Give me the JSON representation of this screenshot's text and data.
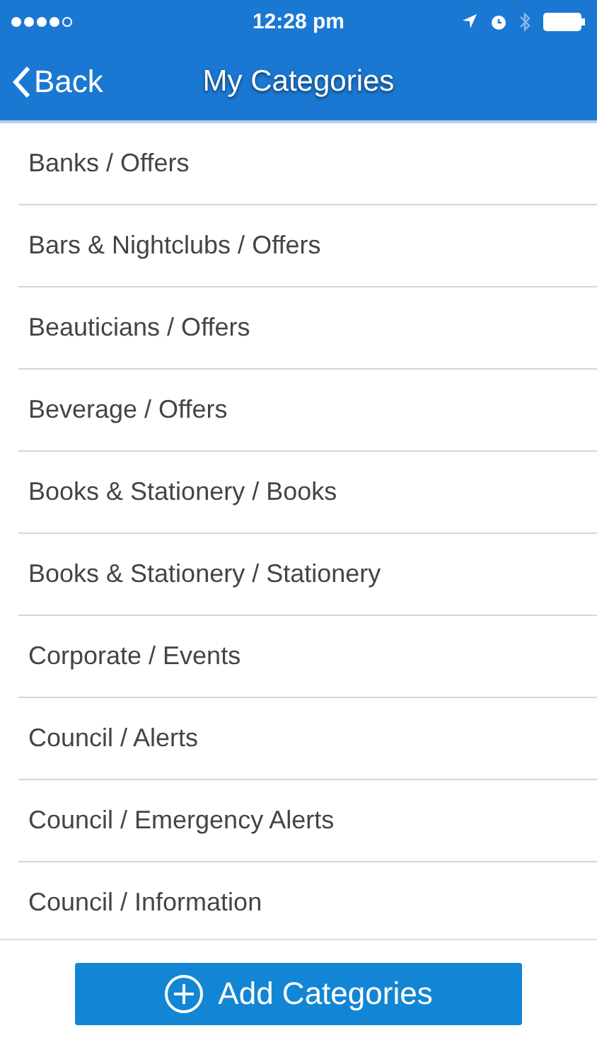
{
  "status_bar": {
    "time": "12:28 pm"
  },
  "nav": {
    "back": "Back",
    "title": "My Categories"
  },
  "categories": [
    "Banks / Offers",
    "Bars & Nightclubs / Offers",
    "Beauticians / Offers",
    "Beverage / Offers",
    "Books & Stationery / Books",
    "Books & Stationery / Stationery",
    "Corporate / Events",
    "Council / Alerts",
    "Council / Emergency Alerts",
    "Council / Information"
  ],
  "add_button": "Add Categories"
}
